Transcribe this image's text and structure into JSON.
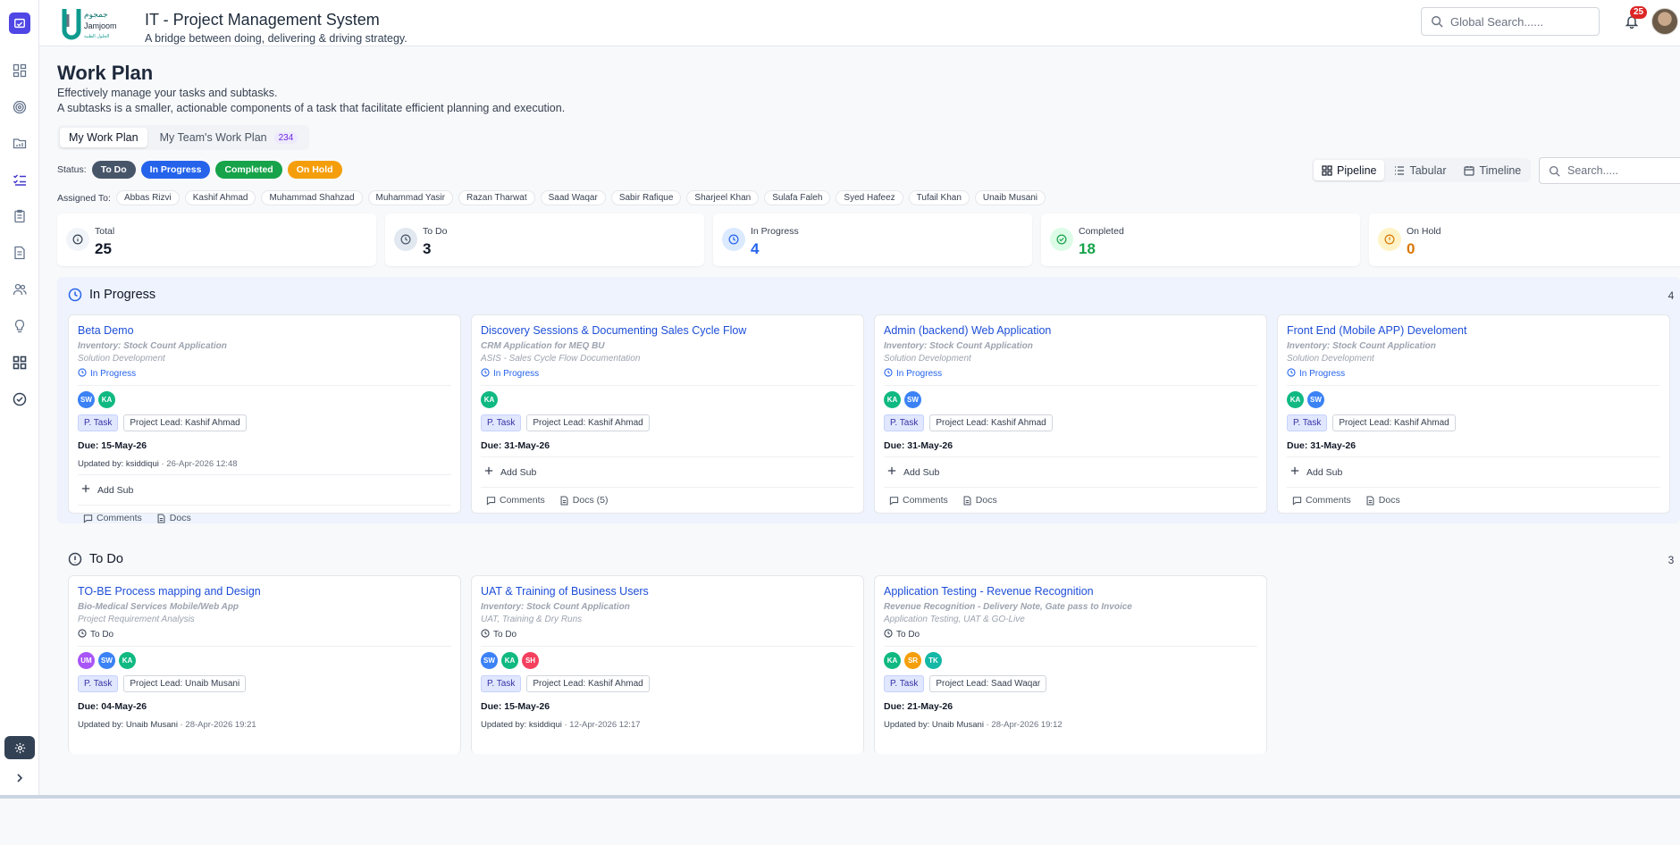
{
  "header": {
    "title": "IT - Project Management System",
    "subtitle": "A bridge between doing, delivering & driving strategy.",
    "logo_text": "Jamjoom",
    "search_placeholder": "Global Search......",
    "notif_count": "25"
  },
  "page": {
    "title": "Work Plan",
    "desc1": "Effectively manage your tasks and subtasks.",
    "desc2": "A subtasks is a smaller, actionable components of a task that facilitate efficient planning and execution."
  },
  "tabs": [
    {
      "label": "My Work Plan"
    },
    {
      "label": "My Team's Work Plan",
      "count": "234"
    }
  ],
  "status": {
    "label": "Status:",
    "items": [
      {
        "label": "To Do",
        "color": "#475569"
      },
      {
        "label": "In Progress",
        "color": "#2563eb"
      },
      {
        "label": "Completed",
        "color": "#16a34a"
      },
      {
        "label": "On Hold",
        "color": "#f59e0b"
      }
    ]
  },
  "views": {
    "pipeline": "Pipeline",
    "tabular": "Tabular",
    "timeline": "Timeline",
    "search_placeholder": "Search....."
  },
  "assigned": {
    "label": "Assigned To:",
    "people": [
      "Abbas Rizvi",
      "Kashif Ahmad",
      "Muhammad Shahzad",
      "Muhammad Yasir",
      "Razan Tharwat",
      "Saad Waqar",
      "Sabir Rafique",
      "Sharjeel Khan",
      "Sulafa Faleh",
      "Syed Hafeez",
      "Tufail Khan",
      "Unaib Musani"
    ]
  },
  "stats": [
    {
      "label": "Total",
      "value": "25",
      "color": "#111827",
      "bg": "#f1f5f9",
      "icon": "info-icon"
    },
    {
      "label": "To Do",
      "value": "3",
      "color": "#111827",
      "bg": "#e2e8f0",
      "icon": "clock-icon"
    },
    {
      "label": "In Progress",
      "value": "4",
      "color": "#2563eb",
      "bg": "#dbeafe",
      "icon": "clock-icon"
    },
    {
      "label": "Completed",
      "value": "18",
      "color": "#16a34a",
      "bg": "#dcfce7",
      "icon": "check-circle-icon"
    },
    {
      "label": "On Hold",
      "value": "0",
      "color": "#d97706",
      "bg": "#fef3c7",
      "icon": "alert-icon"
    }
  ],
  "groups": {
    "in_progress": {
      "title": "In Progress",
      "count": "4"
    },
    "todo": {
      "title": "To Do",
      "count": "3"
    }
  },
  "labels": {
    "ptask": "P. Task",
    "add_sub": "Add Sub",
    "comments": "Comments",
    "docs": "Docs",
    "due_prefix": "Due: ",
    "updated_prefix": "Updated by: "
  },
  "in_progress_cards": [
    {
      "title": "Beta Demo",
      "project": "Inventory: Stock Count Application",
      "sub": "Solution Development",
      "status": "In Progress",
      "avatars": [
        {
          "i": "SW",
          "c": "#3b82f6"
        },
        {
          "i": "KA",
          "c": "#10b981"
        }
      ],
      "lead": "Project Lead: Kashif Ahmad",
      "due": "15-May-26",
      "updated_by": "ksiddiqui",
      "updated_at": " · 26-Apr-2026 12:48",
      "docs": "Docs"
    },
    {
      "title": "Discovery Sessions & Documenting Sales Cycle Flow",
      "project": "CRM Application for MEQ BU",
      "sub": "ASIS - Sales Cycle Flow Documentation",
      "status": "In Progress",
      "avatars": [
        {
          "i": "KA",
          "c": "#10b981"
        }
      ],
      "lead": "Project Lead: Kashif Ahmad",
      "due": "31-May-26",
      "docs": "Docs (5)"
    },
    {
      "title": "Admin (backend) Web Application",
      "project": "Inventory: Stock Count Application",
      "sub": "Solution Development",
      "status": "In Progress",
      "avatars": [
        {
          "i": "KA",
          "c": "#10b981"
        },
        {
          "i": "SW",
          "c": "#3b82f6"
        }
      ],
      "lead": "Project Lead: Kashif Ahmad",
      "due": "31-May-26",
      "docs": "Docs"
    },
    {
      "title": "Front End (Mobile APP) Develoment",
      "project": "Inventory: Stock Count Application",
      "sub": "Solution Development",
      "status": "In Progress",
      "avatars": [
        {
          "i": "KA",
          "c": "#10b981"
        },
        {
          "i": "SW",
          "c": "#3b82f6"
        }
      ],
      "lead": "Project Lead: Kashif Ahmad",
      "due": "31-May-26",
      "docs": "Docs"
    }
  ],
  "todo_cards": [
    {
      "title": "TO-BE Process mapping and Design",
      "project": "Bio-Medical Services Mobile/Web App",
      "sub": "Project Requirement Analysis",
      "status": "To Do",
      "avatars": [
        {
          "i": "UM",
          "c": "#a855f7"
        },
        {
          "i": "SW",
          "c": "#3b82f6"
        },
        {
          "i": "KA",
          "c": "#10b981"
        }
      ],
      "lead": "Project Lead: Unaib Musani",
      "due": "04-May-26",
      "updated_by": "Unaib Musani",
      "updated_at": " · 28-Apr-2026 19:21"
    },
    {
      "title": "UAT & Training of Business Users",
      "project": "Inventory: Stock Count Application",
      "sub": "UAT, Training & Dry Runs",
      "status": "To Do",
      "avatars": [
        {
          "i": "SW",
          "c": "#3b82f6"
        },
        {
          "i": "KA",
          "c": "#10b981"
        },
        {
          "i": "SH",
          "c": "#f43f5e"
        }
      ],
      "lead": "Project Lead: Kashif Ahmad",
      "due": "15-May-26",
      "updated_by": "ksiddiqui",
      "updated_at": " · 12-Apr-2026 12:17"
    },
    {
      "title": "Application Testing - Revenue Recognition",
      "project": "Revenue Recognition - Delivery Note, Gate pass to Invoice",
      "sub": "Application Testing, UAT & GO-Live",
      "status": "To Do",
      "avatars": [
        {
          "i": "KA",
          "c": "#10b981"
        },
        {
          "i": "SR",
          "c": "#f59e0b"
        },
        {
          "i": "TK",
          "c": "#14b8a6"
        }
      ],
      "lead": "Project Lead: Saad Waqar",
      "due": "21-May-26",
      "updated_by": "Unaib Musani",
      "updated_at": " · 28-Apr-2026 19:12"
    }
  ]
}
